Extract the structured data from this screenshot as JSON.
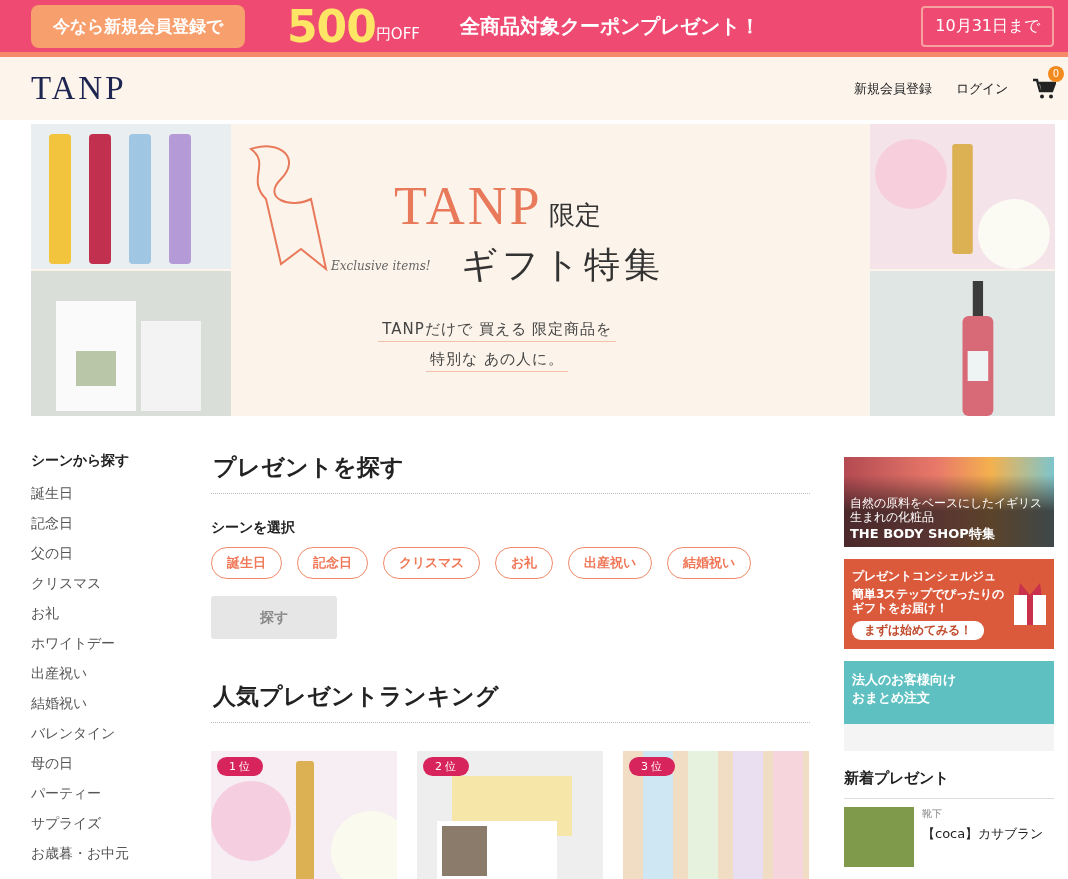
{
  "promo_bar": {
    "lead": "今なら新規会員登録で",
    "amount": "500",
    "unit": "円OFF",
    "message": "全商品対象クーポンプレゼント！",
    "deadline": "10月31日まで"
  },
  "header": {
    "logo": "TANP",
    "links": [
      "新規会員登録",
      "ログイン"
    ],
    "cart_count": "0"
  },
  "hero": {
    "brand": "TANP",
    "limited": "限定",
    "script": "Exclusive items!",
    "title": "ギフト特集",
    "lines": [
      "TANPだけで 買える 限定商品を",
      "特別な あの人に。"
    ]
  },
  "sidebar": {
    "heading": "シーンから探す",
    "items": [
      "誕生日",
      "記念日",
      "父の日",
      "クリスマス",
      "お礼",
      "ホワイトデー",
      "出産祝い",
      "結婚祝い",
      "バレンタイン",
      "母の日",
      "パーティー",
      "サプライズ",
      "お歳暮・お中元"
    ]
  },
  "search": {
    "heading": "プレゼントを探す",
    "label": "シーンを選択",
    "chips": [
      "誕生日",
      "記念日",
      "クリスマス",
      "お礼",
      "出産祝い",
      "結婚祝い"
    ],
    "button": {
      "label": "探す",
      "disabled": true
    }
  },
  "ranking": {
    "heading": "人気プレゼントランキング",
    "items": [
      {
        "rank": "1 位",
        "kind": "lipstick"
      },
      {
        "rank": "2 位",
        "kind": "card"
      },
      {
        "rank": "3 位",
        "kind": "bottles"
      }
    ]
  },
  "side_banners": [
    {
      "kind": "bodyshop",
      "sub": "自然の原料をベースにしたイギリス生まれの化粧品",
      "title": "THE BODY SHOP特集"
    },
    {
      "kind": "concierge",
      "title": "プレゼントコンシェルジュ",
      "sub": "簡単3ステップでぴったりのギフトをお届け！",
      "cta": "まずは始めてみる！"
    },
    {
      "kind": "corporate",
      "lines": [
        "法人のお客様向け",
        "おまとめ注文"
      ]
    }
  ],
  "new_arrivals": {
    "heading": "新着プレゼント",
    "items": [
      {
        "category": "靴下",
        "title": "【coca】カサブラン"
      }
    ]
  }
}
